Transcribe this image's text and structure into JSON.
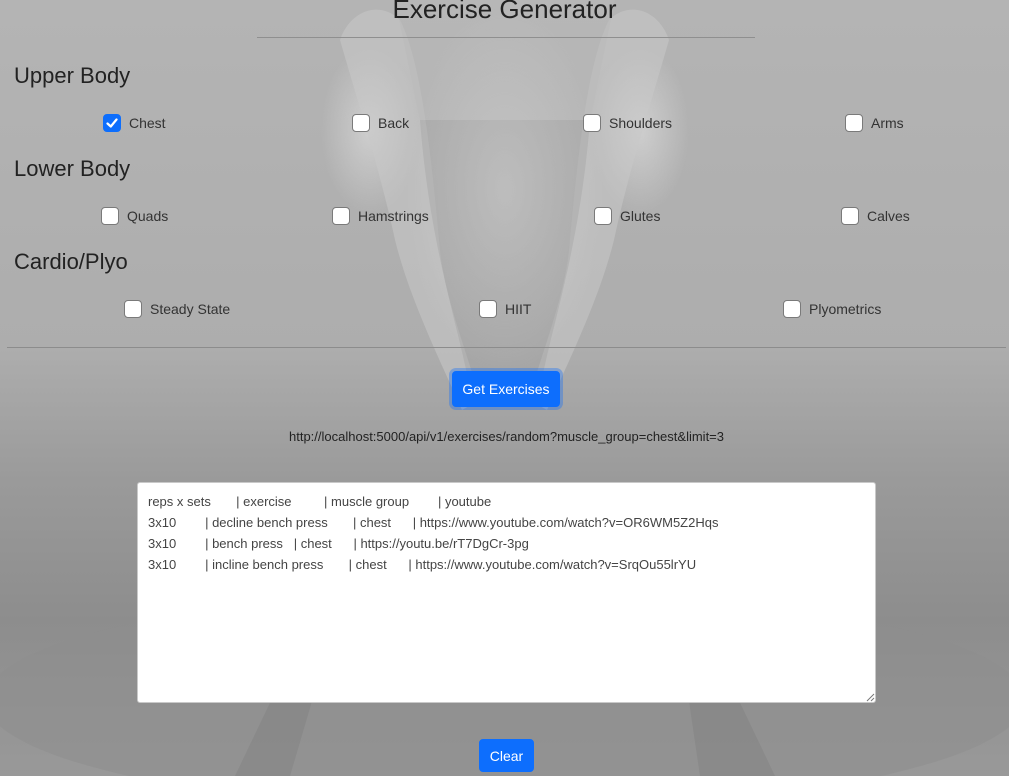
{
  "header": {
    "title": "Exercise Generator"
  },
  "sections": {
    "upper": {
      "heading": "Upper Body",
      "options": [
        {
          "label": "Chest",
          "checked": true
        },
        {
          "label": "Back",
          "checked": false
        },
        {
          "label": "Shoulders",
          "checked": false
        },
        {
          "label": "Arms",
          "checked": false
        }
      ]
    },
    "lower": {
      "heading": "Lower Body",
      "options": [
        {
          "label": "Quads",
          "checked": false
        },
        {
          "label": "Hamstrings",
          "checked": false
        },
        {
          "label": "Glutes",
          "checked": false
        },
        {
          "label": "Calves",
          "checked": false
        }
      ]
    },
    "cardio": {
      "heading": "Cardio/Plyo",
      "options": [
        {
          "label": "Steady State",
          "checked": false
        },
        {
          "label": "HIIT",
          "checked": false
        },
        {
          "label": "Plyometrics",
          "checked": false
        }
      ]
    }
  },
  "actions": {
    "get_label": "Get Exercises",
    "clear_label": "Clear"
  },
  "request_url": "http://localhost:5000/api/v1/exercises/random?muscle_group=chest&limit=3",
  "output": {
    "lines": [
      "reps x sets       | exercise         | muscle group        | youtube",
      "3x10        | decline bench press       | chest      | https://www.youtube.com/watch?v=OR6WM5Z2Hqs",
      "3x10        | bench press   | chest      | https://youtu.be/rT7DgCr-3pg",
      "3x10        | incline bench press       | chest      | https://www.youtube.com/watch?v=SrqOu55lrYU"
    ]
  },
  "colors": {
    "primary": "#0d6efd",
    "background": "#adadad"
  }
}
